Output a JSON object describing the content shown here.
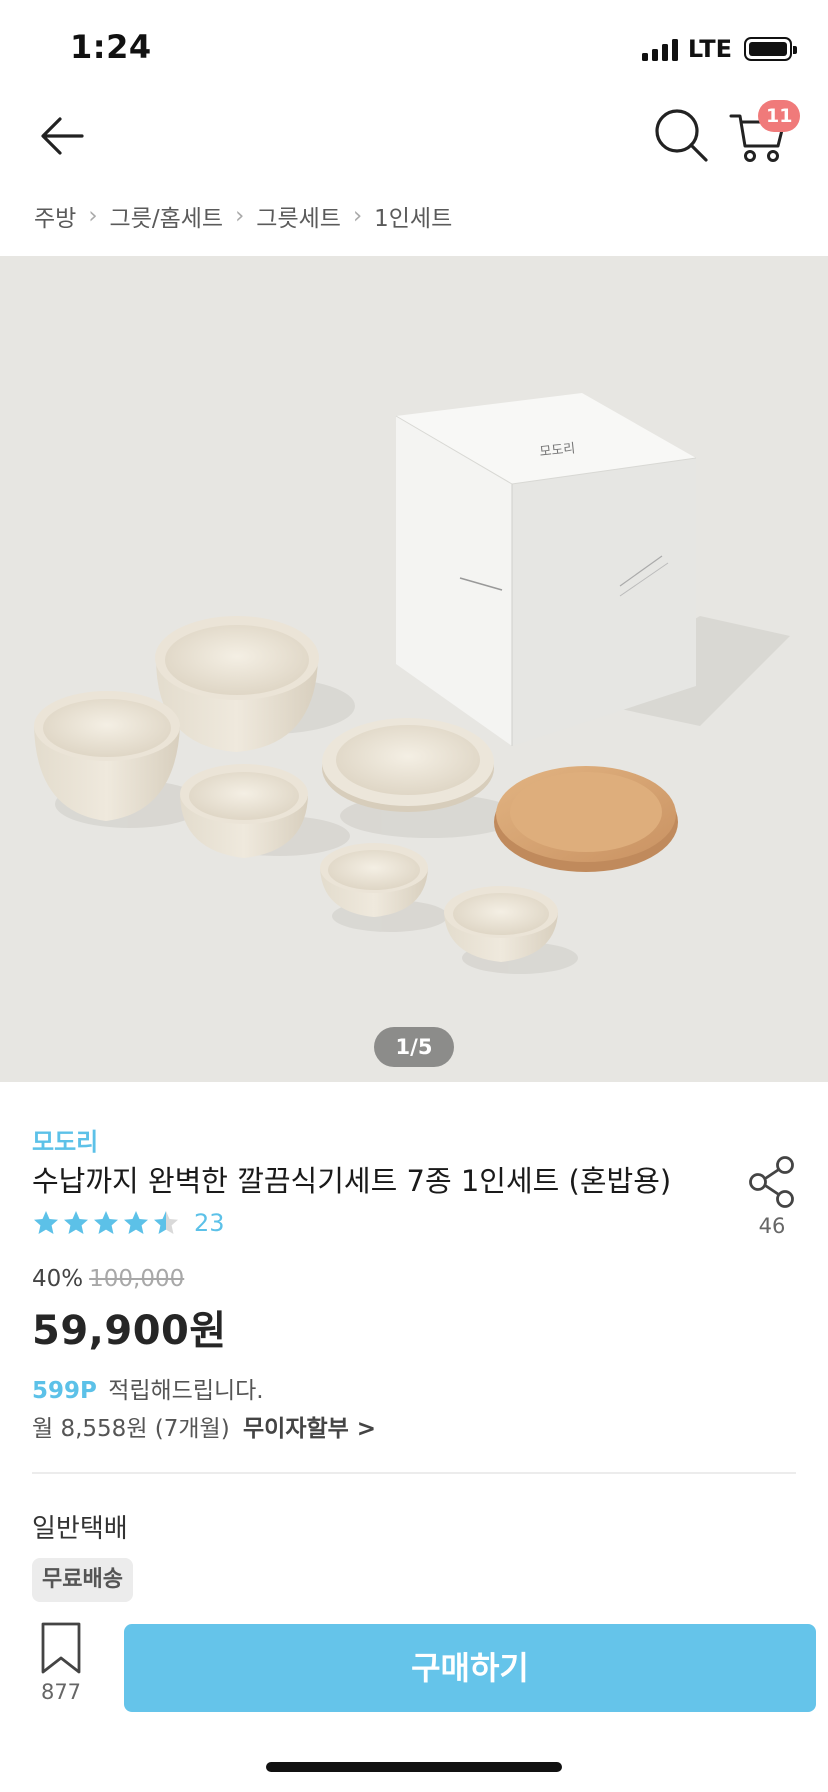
{
  "status_bar": {
    "time": "1:24",
    "network": "LTE"
  },
  "nav": {
    "cart_count": "11"
  },
  "breadcrumb": [
    "주방",
    "그릇/홈세트",
    "그릇세트",
    "1인세트"
  ],
  "gallery": {
    "counter": "1/5",
    "box_logo": "모도리"
  },
  "product": {
    "brand": "모도리",
    "title": "수납까지 완벽한 깔끔식기세트 7종 1인세트 (혼밥용)",
    "rating": 4.5,
    "review_count": "23",
    "share_count": "46"
  },
  "price": {
    "discount": "40%",
    "original": "100,000",
    "sale": "59,900원",
    "points": "599P",
    "points_text": "적립해드립니다.",
    "installment_text": "월 8,558원 (7개월)",
    "installment_link": "무이자할부 >"
  },
  "shipping": {
    "title": "일반택배",
    "badge": "무료배송"
  },
  "bottom_bar": {
    "bookmark_count": "877",
    "buy_label": "구매하기"
  },
  "colors": {
    "accent": "#5cc1e8",
    "buy_button": "#65c4ea",
    "badge": "#f07a7a",
    "gallery_bg": "#e7e6e2"
  }
}
